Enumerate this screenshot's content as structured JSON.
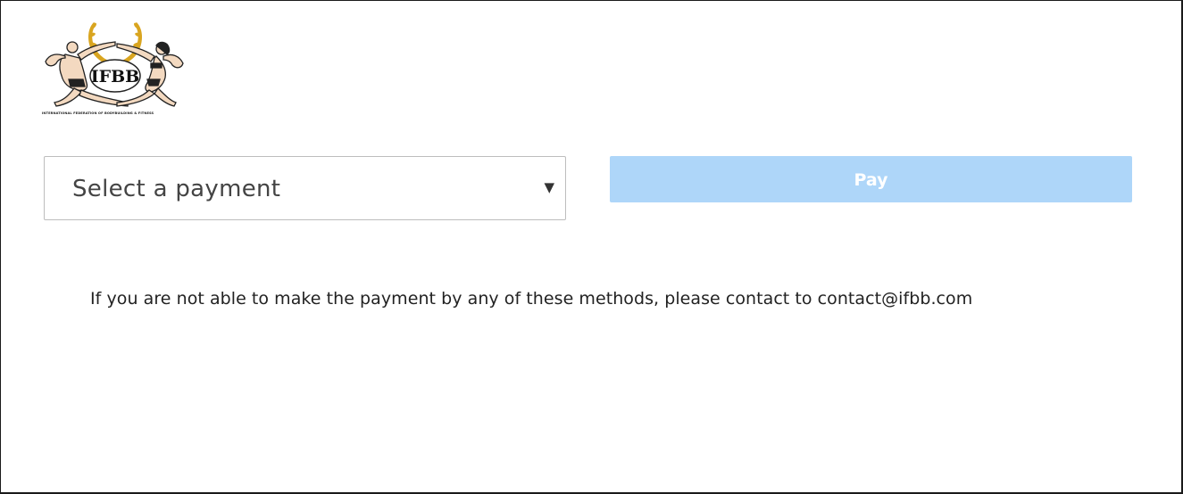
{
  "logo": {
    "icon": "ifbb-logo",
    "text": "IFBB",
    "tagline": "INTERNATIONAL FEDERATION OF BODYBUILDING & FITNESS"
  },
  "payment_select": {
    "value": "Select a payment",
    "caret": "▼"
  },
  "pay_button": {
    "label": "Pay",
    "state": "disabled",
    "color": "#aed6f9"
  },
  "notice": {
    "text": "If you are not able to make the payment by any of these methods, please contact to contact@ifbb.com"
  }
}
